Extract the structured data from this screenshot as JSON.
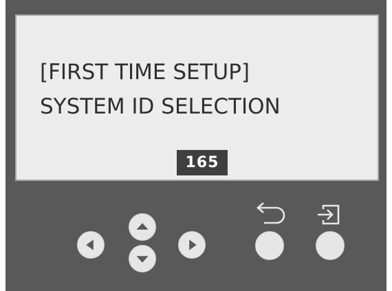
{
  "display": {
    "line1": "[FIRST TIME SETUP]",
    "line2": "SYSTEM ID SELECTION",
    "value": "165"
  },
  "controls": {
    "left": "left-arrow-icon",
    "up": "up-arrow-icon",
    "down": "down-arrow-icon",
    "right": "right-arrow-icon",
    "back": "return-arrow-icon",
    "enter": "enter-icon"
  },
  "colors": {
    "panel": "#595959",
    "screen": "#ececec",
    "text": "#2f2f2f",
    "highlight": "#3f3f3f",
    "button": "#e6e6e6",
    "glyph": "#595959"
  }
}
